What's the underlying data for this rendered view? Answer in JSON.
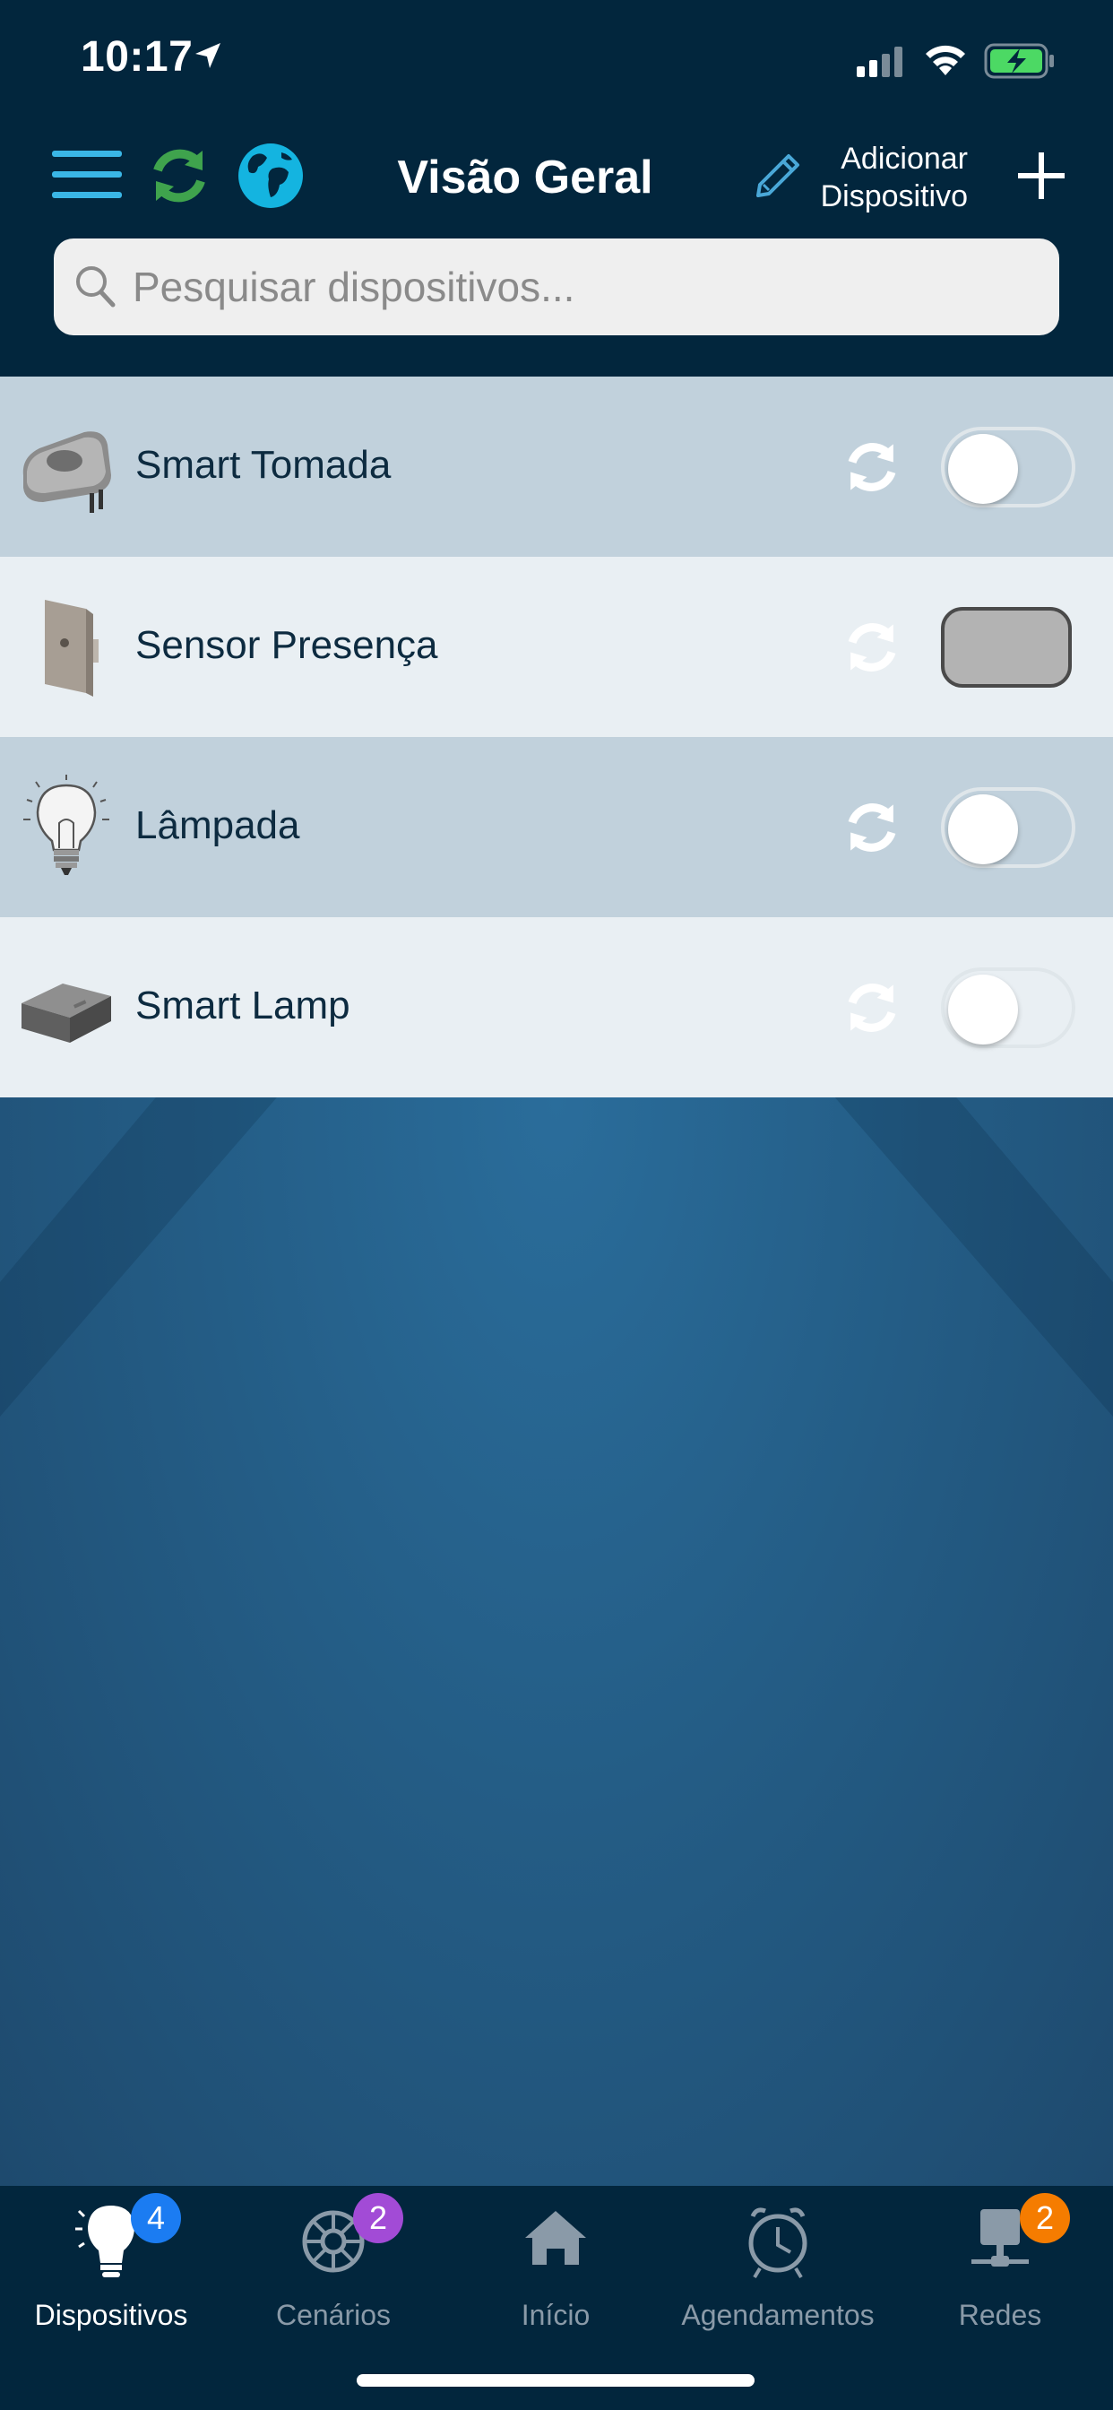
{
  "status_bar": {
    "time": "10:17"
  },
  "header": {
    "title": "Visão Geral",
    "add_device_line1": "Adicionar",
    "add_device_line2": "Dispositivo"
  },
  "search": {
    "placeholder": "Pesquisar dispositivos..."
  },
  "devices": [
    {
      "name": "Smart Tomada",
      "icon": "smart-plug",
      "state": "off"
    },
    {
      "name": "Sensor Presença",
      "icon": "presence-sensor",
      "state": "disabled"
    },
    {
      "name": "Lâmpada",
      "icon": "light-bulb",
      "state": "off"
    },
    {
      "name": "Smart Lamp",
      "icon": "smart-hub-box",
      "state": "off"
    }
  ],
  "tabs": [
    {
      "label": "Dispositivos",
      "icon": "bulb-icon",
      "badge": "4",
      "badge_color": "#1b7cf2",
      "active": true
    },
    {
      "label": "Cenários",
      "icon": "scenes-icon",
      "badge": "2",
      "badge_color": "#a24bd6",
      "active": false
    },
    {
      "label": "Início",
      "icon": "home-icon",
      "badge": "",
      "active": false
    },
    {
      "label": "Agendamentos",
      "icon": "alarm-clock-icon",
      "badge": "",
      "active": false
    },
    {
      "label": "Redes",
      "icon": "network-icon",
      "badge": "2",
      "badge_color": "#f57c00",
      "active": false
    }
  ],
  "colors": {
    "header_bg": "#02263d",
    "refresh_green": "#3fa34d",
    "globe_cyan": "#14b4e0",
    "accent_blue": "#4aa8d8"
  }
}
